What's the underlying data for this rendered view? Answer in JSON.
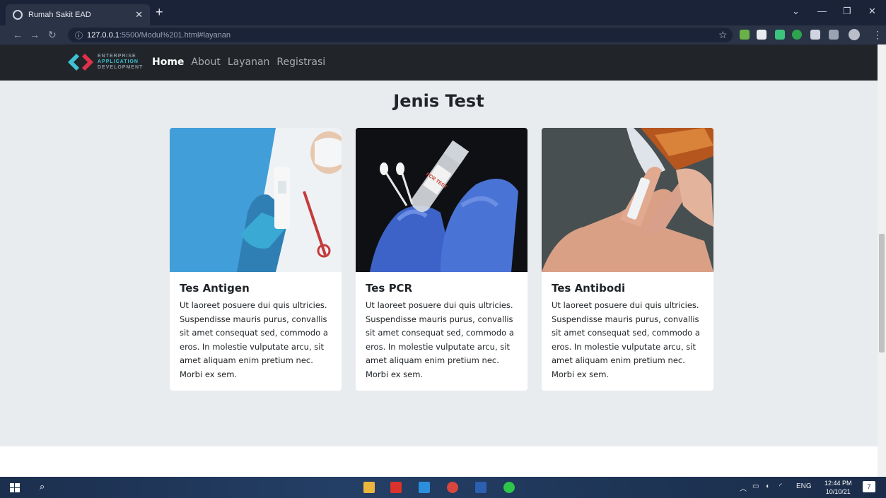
{
  "browser": {
    "tab_title": "Rumah Sakit EAD",
    "url_host": "127.0.0.1",
    "url_path": ":5500/Modul%201.html#layanan"
  },
  "site": {
    "brand": {
      "line1": "ENTERPRISE",
      "line2": "APPLICATION",
      "line3": "DEVELOPMENT"
    },
    "nav": [
      {
        "label": "Home",
        "active": true
      },
      {
        "label": "About",
        "active": false
      },
      {
        "label": "Layanan",
        "active": false
      },
      {
        "label": "Registrasi",
        "active": false
      }
    ]
  },
  "section": {
    "title": "Jenis Test",
    "cards": [
      {
        "title": "Tes Antigen",
        "text": "Ut laoreet posuere dui quis ultricies. Suspendisse mauris purus, convallis sit amet consequat sed, commodo a eros. In molestie vulputate arcu, sit amet aliquam enim pretium nec. Morbi ex sem."
      },
      {
        "title": "Tes PCR",
        "text": "Ut laoreet posuere dui quis ultricies. Suspendisse mauris purus, convallis sit amet consequat sed, commodo a eros. In molestie vulputate arcu, sit amet aliquam enim pretium nec. Morbi ex sem."
      },
      {
        "title": "Tes Antibodi",
        "text": "Ut laoreet posuere dui quis ultricies. Suspendisse mauris purus, convallis sit amet consequat sed, commodo a eros. In molestie vulputate arcu, sit amet aliquam enim pretium nec. Morbi ex sem."
      }
    ],
    "pcr_tube_label": "PCR TEST"
  },
  "taskbar": {
    "lang": "ENG",
    "time": "12:44 PM",
    "date": "10/10/21",
    "notifications": "7"
  },
  "colors": {
    "navbar": "#212529",
    "section_bg": "#e9ecef",
    "brand_accent": "#3ec1d3",
    "brand_red": "#e0314b"
  }
}
